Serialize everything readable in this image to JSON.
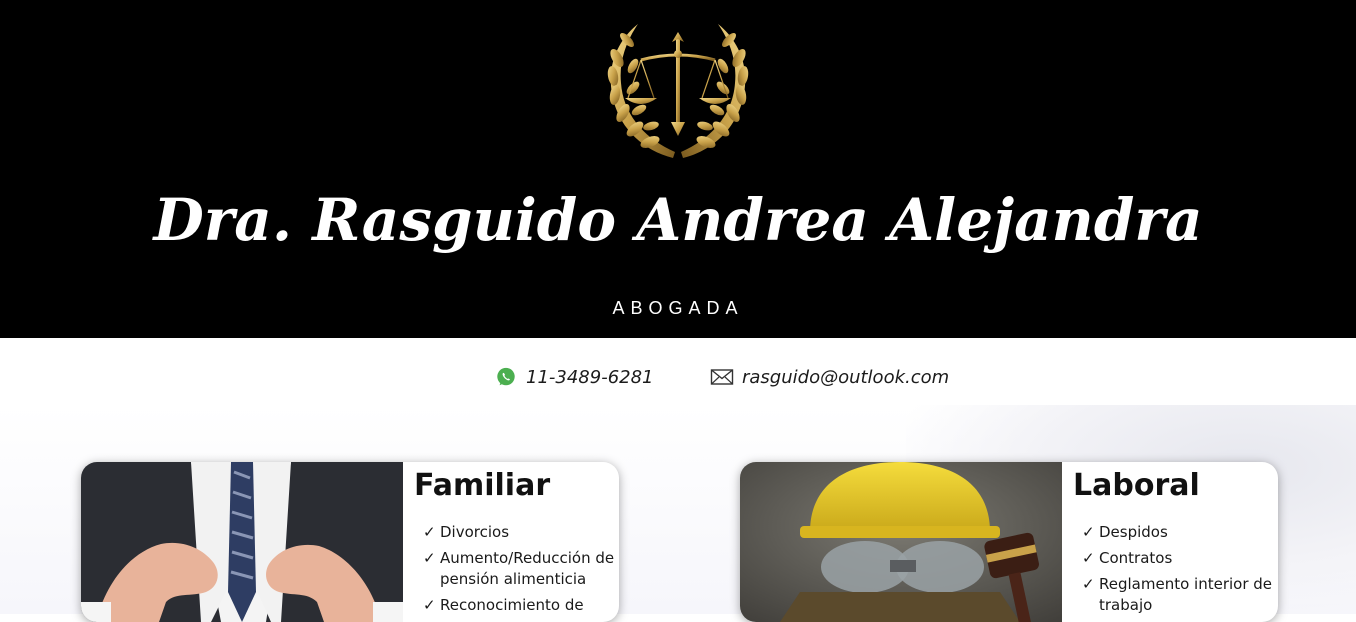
{
  "header": {
    "name": "Dra. Rasguido Andrea Alejandra",
    "subtitle": "ABOGADA",
    "logo_icon": "scales-of-justice-laurel-icon"
  },
  "contact": {
    "phone": "11-3489-6281",
    "phone_icon": "whatsapp-icon",
    "email": "rasguido@outlook.com",
    "email_icon": "envelope-icon"
  },
  "colors": {
    "header_bg": "#000000",
    "gold": "#c9a24a",
    "whatsapp_green": "#4caf50",
    "text_dark": "#1a1a1a"
  },
  "cards": [
    {
      "title": "Familiar",
      "check": "✓",
      "items": [
        "Divorcios",
        "Aumento/Reducción de pensión alimenticia",
        "Reconocimiento de"
      ]
    },
    {
      "title": "Laboral",
      "check": "✓",
      "items": [
        "Despidos",
        "Contratos",
        "Reglamento interior de trabajo"
      ]
    }
  ]
}
